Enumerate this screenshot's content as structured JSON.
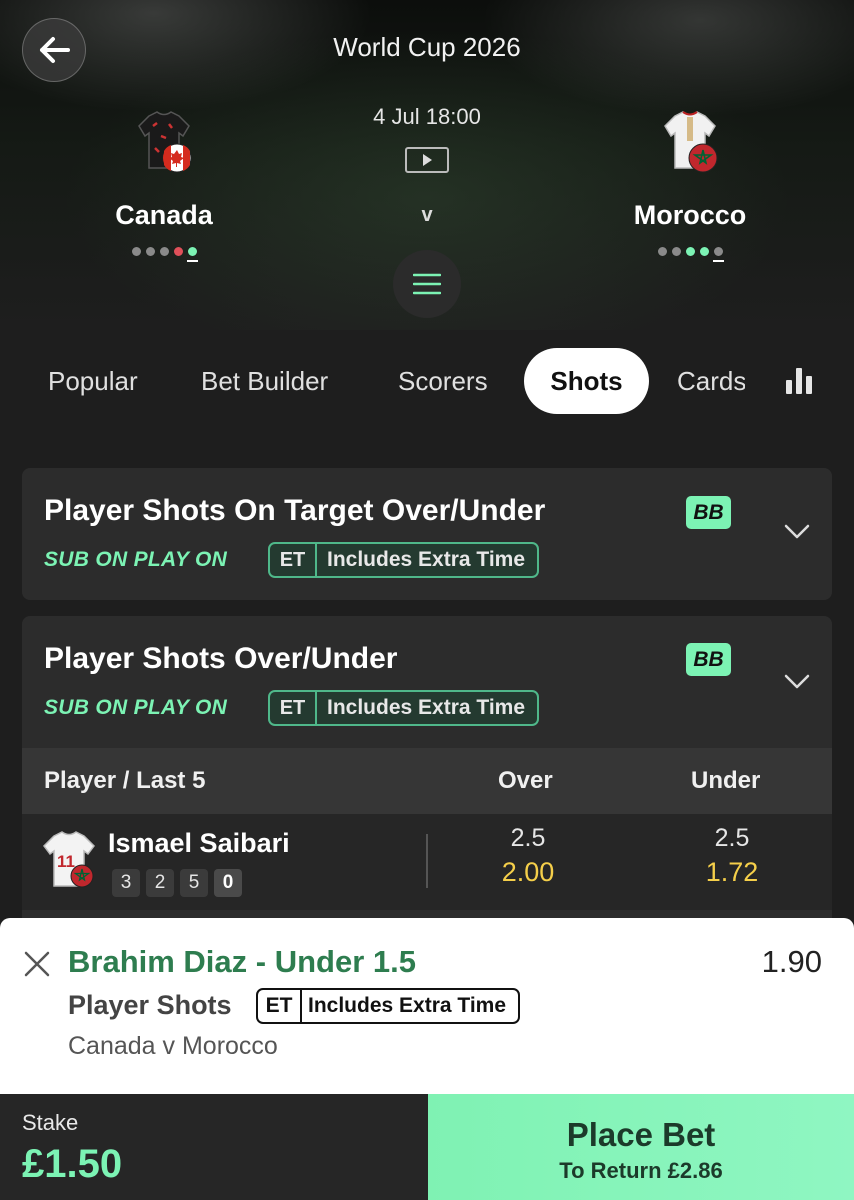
{
  "header": {
    "title": "World Cup 2026",
    "datetime": "4 Jul 18:00",
    "versus": "v",
    "home": {
      "name": "Canada",
      "form": [
        "grey",
        "grey",
        "grey",
        "red",
        "green"
      ]
    },
    "away": {
      "name": "Morocco",
      "form": [
        "grey",
        "grey",
        "green",
        "green",
        "grey"
      ]
    }
  },
  "tabs": [
    {
      "label": "Popular"
    },
    {
      "label": "Bet Builder"
    },
    {
      "label": "Scorers"
    },
    {
      "label": "Shots",
      "active": true
    },
    {
      "label": "Cards"
    }
  ],
  "markets": [
    {
      "title": "Player Shots On Target Over/Under",
      "badge": "BB",
      "sub_label": "SUB ON PLAY ON",
      "et_short": "ET",
      "et_text": "Includes Extra Time"
    },
    {
      "title": "Player Shots Over/Under",
      "badge": "BB",
      "sub_label": "SUB ON PLAY ON",
      "et_short": "ET",
      "et_text": "Includes Extra Time",
      "table": {
        "headers": [
          "Player / Last 5",
          "Over",
          "Under"
        ],
        "rows": [
          {
            "player": "Ismael Saibari",
            "shirt_number": "11",
            "last5": [
              "3",
              "2",
              "5",
              "0"
            ],
            "over": {
              "line": "2.5",
              "price": "2.00"
            },
            "under": {
              "line": "2.5",
              "price": "1.72"
            }
          }
        ]
      }
    }
  ],
  "betslip": {
    "selection": "Brahim Diaz - Under 1.5",
    "odds": "1.90",
    "market": "Player Shots",
    "et_short": "ET",
    "et_text": "Includes Extra Time",
    "match": "Canada v Morocco",
    "stake_label": "Stake",
    "stake_value": "£1.50",
    "place_label": "Place Bet",
    "return_label": "To Return £2.86"
  },
  "colors": {
    "accent": "#7cf3b4",
    "price": "#f5cf4a",
    "selection": "#2e7d4f"
  }
}
